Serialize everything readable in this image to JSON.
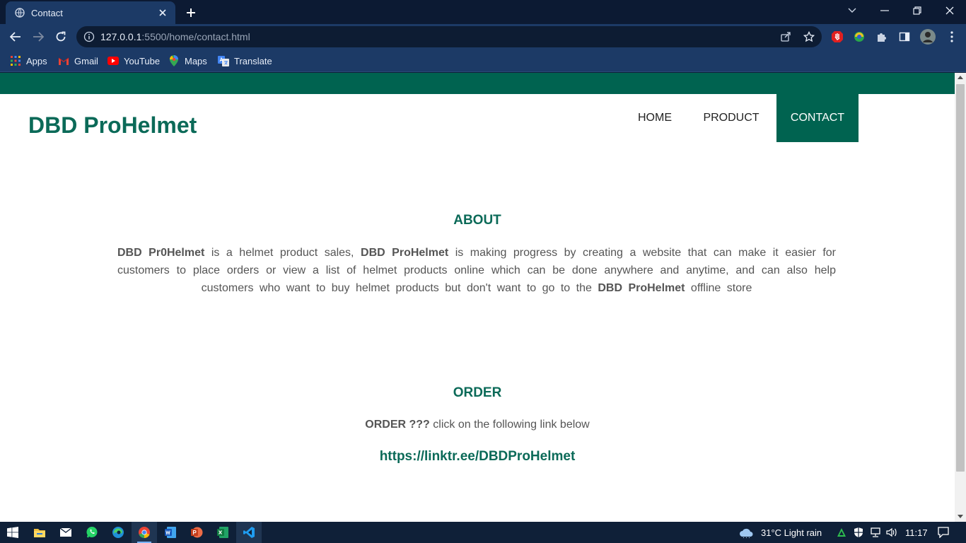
{
  "browser": {
    "tab": {
      "title": "Contact"
    },
    "url": {
      "host": "127.0.0.1",
      "rest": ":5500/home/contact.html"
    },
    "bookmarks": [
      {
        "label": "Apps",
        "icon": "apps-grid-icon"
      },
      {
        "label": "Gmail",
        "icon": "gmail-icon"
      },
      {
        "label": "YouTube",
        "icon": "youtube-icon"
      },
      {
        "label": "Maps",
        "icon": "maps-icon"
      },
      {
        "label": "Translate",
        "icon": "translate-icon"
      }
    ]
  },
  "page": {
    "brand": "DBD ProHelmet",
    "nav": {
      "home": "HOME",
      "product": "PRODUCT",
      "contact": "CONTACT"
    },
    "about": {
      "title": "ABOUT",
      "b1": "DBD Pr0Helmet",
      "t1": " is a helmet product sales, ",
      "b2": "DBD ProHelmet",
      "t2": " is making progress by creating a website that can make it easier for customers to place orders or view a list of helmet products online which can be done anywhere and anytime, and can also help customers who want to buy helmet products but don't want to go to the ",
      "b3": "DBD ProHelmet",
      "t3": " offline store"
    },
    "order": {
      "title": "ORDER",
      "bold": "ORDER ???",
      "text": " click on the following link below",
      "link": "https://linktr.ee/DBDProHelmet"
    }
  },
  "taskbar": {
    "weather": "31°C  Light rain",
    "time": "11:17"
  },
  "colors": {
    "brand_green": "#006350",
    "heading_green": "#0b6a58",
    "chrome_blue": "#1c3a66"
  }
}
